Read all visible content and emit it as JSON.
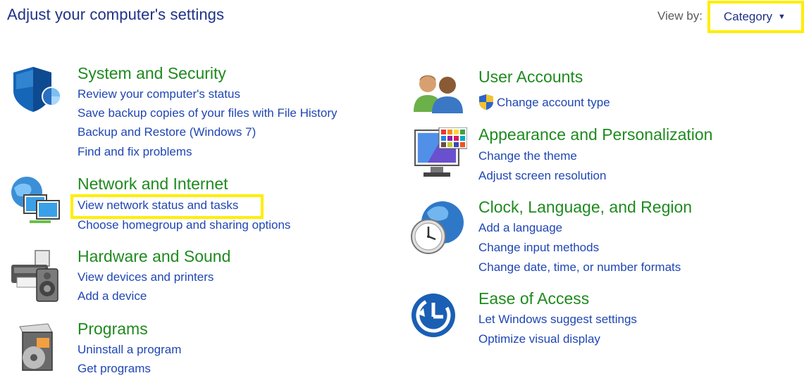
{
  "header": {
    "title": "Adjust your computer's settings",
    "view_by_label": "View by:",
    "view_by_value": "Category"
  },
  "categories": [
    {
      "title": "System and Security",
      "links": [
        "Review your computer's status",
        "Save backup copies of your files with File History",
        "Backup and Restore (Windows 7)",
        "Find and fix problems"
      ]
    },
    {
      "title": "Network and Internet",
      "links": [
        "View network status and tasks",
        "Choose homegroup and sharing options"
      ]
    },
    {
      "title": "Hardware and Sound",
      "links": [
        "View devices and printers",
        "Add a device"
      ]
    },
    {
      "title": "Programs",
      "links": [
        "Uninstall a program",
        "Get programs"
      ]
    },
    {
      "title": "User Accounts",
      "links": [
        "Change account type"
      ]
    },
    {
      "title": "Appearance and Personalization",
      "links": [
        "Change the theme",
        "Adjust screen resolution"
      ]
    },
    {
      "title": "Clock, Language, and Region",
      "links": [
        "Add a language",
        "Change input methods",
        "Change date, time, or number formats"
      ]
    },
    {
      "title": "Ease of Access",
      "links": [
        "Let Windows suggest settings",
        "Optimize visual display"
      ]
    }
  ],
  "icons": {
    "system_security": "shield-icon",
    "network": "network-globe-icon",
    "hardware": "printer-speaker-icon",
    "programs": "programs-disc-icon",
    "user_accounts": "users-icon",
    "uac": "uac-shield-icon",
    "appearance": "monitor-palette-icon",
    "clock": "clock-globe-icon",
    "ease": "ease-of-access-icon",
    "dropdown": "chevron-down-icon"
  },
  "colors": {
    "title": "#1e3287",
    "category_title": "#1f8a1f",
    "link": "#1f46b4",
    "highlight": "#ffee00"
  }
}
